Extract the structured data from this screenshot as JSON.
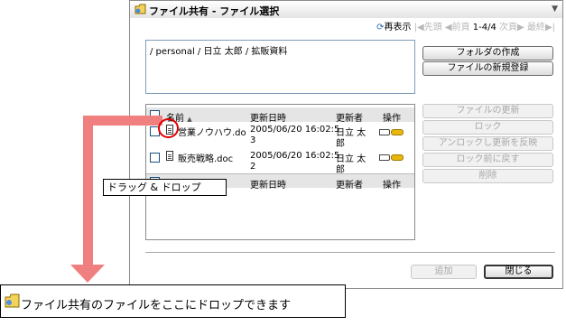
{
  "title": "ファイル共有 - ファイル選択",
  "pager": {
    "refresh": "再表示",
    "first": "先頭",
    "prev": "前頁",
    "range": "1-4/4",
    "next": "次頁",
    "last": "最終"
  },
  "path": "/ personal / 日立 太郎 / 拡販資料",
  "buttons": {
    "create_folder": "フォルダの作成",
    "new_file": "ファイルの新規登録",
    "update_file": "ファイルの更新",
    "lock": "ロック",
    "unlock_apply": "アンロックし更新を反映",
    "revert_lock": "ロック前に戻す",
    "delete": "削除",
    "add": "追加",
    "close": "閉じる"
  },
  "table": {
    "headers": {
      "name": "名前",
      "updated": "更新日時",
      "updater": "更新者",
      "action": "操作"
    },
    "rows": [
      {
        "name": "営業ノウハウ.do",
        "date_line1": "2005/06/20 16:02:5",
        "date_line2": "3",
        "user_line1": "日立 太",
        "user_line2": "郎"
      },
      {
        "name": "販売戦略.doc",
        "date_line1": "2005/06/20 16:02:5",
        "date_line2": "2",
        "user_line1": "日立 太",
        "user_line2": "郎"
      }
    ]
  },
  "annotation": {
    "drag_drop": "ドラッグ & ドロップ",
    "drop_hint": "ファイル共有のファイルをここにドロップできます"
  },
  "colors": {
    "arrow": "#f08080",
    "circle": "#e00000"
  },
  "icons": {
    "title": "file-share-icon",
    "refresh": "refresh-icon",
    "document": "document-icon",
    "operation": "key-icon"
  }
}
